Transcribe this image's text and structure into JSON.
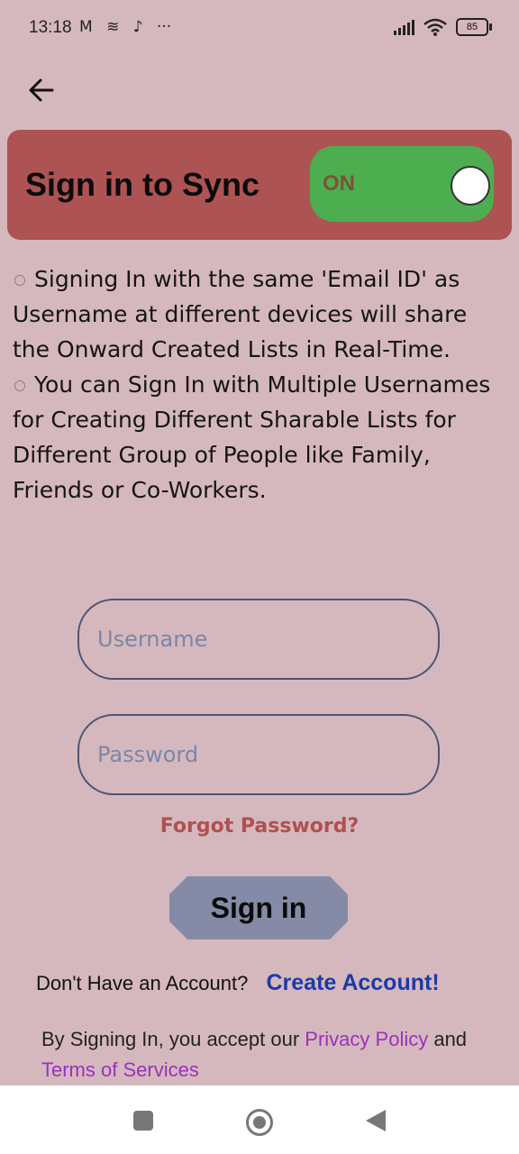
{
  "status_bar": {
    "time": "13:18",
    "icons": [
      "gmail-icon",
      "layers-icon",
      "tiktok-icon",
      "more-icon"
    ],
    "battery": "85"
  },
  "header": {
    "back_icon": "arrow-left-icon"
  },
  "sync": {
    "title": "Sign in to Sync",
    "toggle_label": "ON",
    "toggle_state": "on",
    "card_color": "#ad5353",
    "toggle_color": "#4cae4f"
  },
  "info": {
    "line1": "Signing In with the same 'Email ID' as Username at different devices will share the Onward Created Lists in Real-Time.",
    "line2": "You can Sign In with Multiple Usernames for Creating Different Sharable Lists for Different Group of People like Family, Friends or Co-Workers."
  },
  "form": {
    "username_placeholder": "Username",
    "password_placeholder": "Password",
    "forgot_label": "Forgot Password?",
    "signin_label": "Sign in"
  },
  "account": {
    "prompt": "Don't Have an Account?",
    "create_label": "Create Account!"
  },
  "legal": {
    "prefix": "By Signing In, you accept our ",
    "privacy_label": "Privacy Policy",
    "middle": " and ",
    "terms_label": "Terms of Services"
  },
  "nav_bar": {
    "recents_icon": "square-icon",
    "home_icon": "circle-home-icon",
    "back_icon": "triangle-back-icon"
  }
}
